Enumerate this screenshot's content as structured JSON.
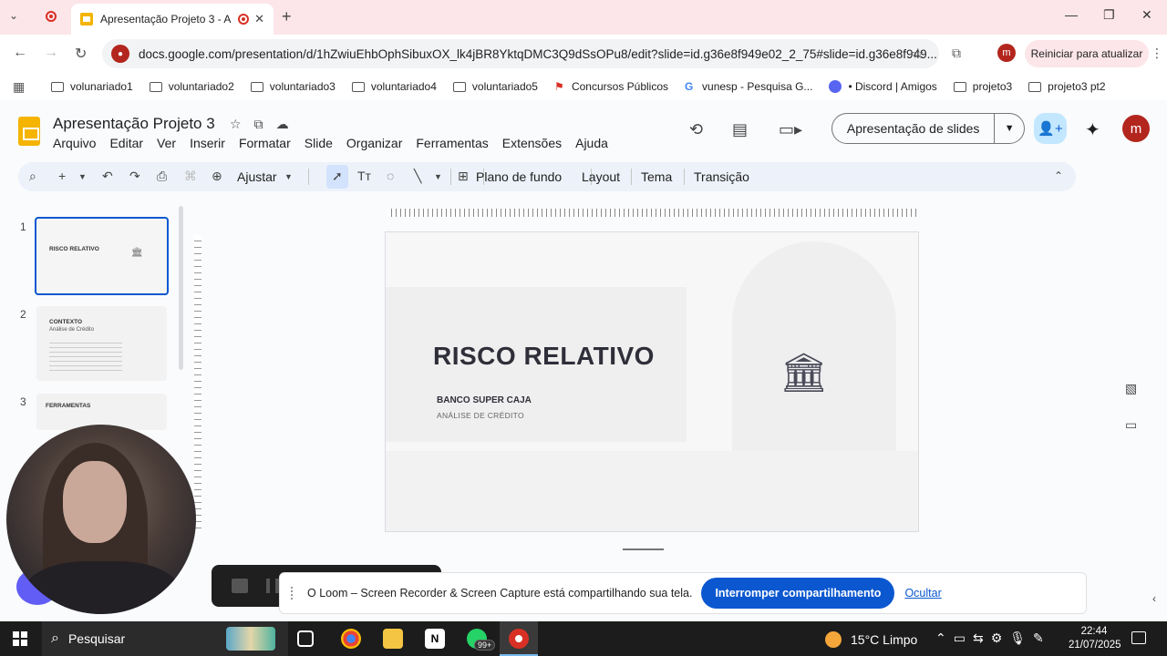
{
  "browser": {
    "tab_title": "Apresentação Projeto 3 - A",
    "url": "docs.google.com/presentation/d/1hZwiuEhbOphSibuxOX_lk4jBR8YktqDMC3Q9dSsOPu8/edit?slide=id.g36e8f949e02_2_75#slide=id.g36e8f949...",
    "profile_initial": "m",
    "restart_label": "Reiniciar para atualizar",
    "bookmarks": [
      "volunariado1",
      "voluntariado2",
      "voluntariado3",
      "voluntariado4",
      "voluntariado5",
      "Concursos Públicos",
      "vunesp - Pesquisa G...",
      "• Discord | Amigos",
      "projeto3",
      "projeto3 pt2"
    ]
  },
  "app": {
    "doc_title": "Apresentação Projeto 3",
    "menu": [
      "Arquivo",
      "Editar",
      "Ver",
      "Inserir",
      "Formatar",
      "Slide",
      "Organizar",
      "Ferramentas",
      "Extensões",
      "Ajuda"
    ],
    "present_label": "Apresentação de slides",
    "avatar_initial": "m"
  },
  "toolbar": {
    "zoom_label": "Ajustar",
    "background_label": "Plano de fundo",
    "layout_label": "Layout",
    "theme_label": "Tema",
    "transition_label": "Transição"
  },
  "filmstrip": {
    "slides": [
      {
        "number": "1",
        "title": "RISCO RELATIVO",
        "subtitle": ""
      },
      {
        "number": "2",
        "title": "CONTEXTO",
        "subtitle": "Análise de Crédito"
      },
      {
        "number": "3",
        "title": "FERRAMENTAS",
        "subtitle": ""
      }
    ]
  },
  "slide": {
    "title": "RISCO RELATIVO",
    "subtitle": "BANCO SUPER CAJA",
    "caption": "ANÁLISE DE CRÉDITO",
    "icon": "bank-icon"
  },
  "share_notice": {
    "message": "O Loom – Screen Recorder & Screen Capture está compartilhando sua tela.",
    "stop_label": "Interromper compartilhamento",
    "hide_label": "Ocultar"
  },
  "taskbar": {
    "search_placeholder": "Pesquisar",
    "whatsapp_badge": "99+",
    "weather": "15°C  Limpo",
    "time": "22:44",
    "date": "21/07/2025"
  },
  "colors": {
    "accent": "#0b57d0",
    "tab_strip": "#fce6ea",
    "slides_brand": "#f4b400"
  }
}
